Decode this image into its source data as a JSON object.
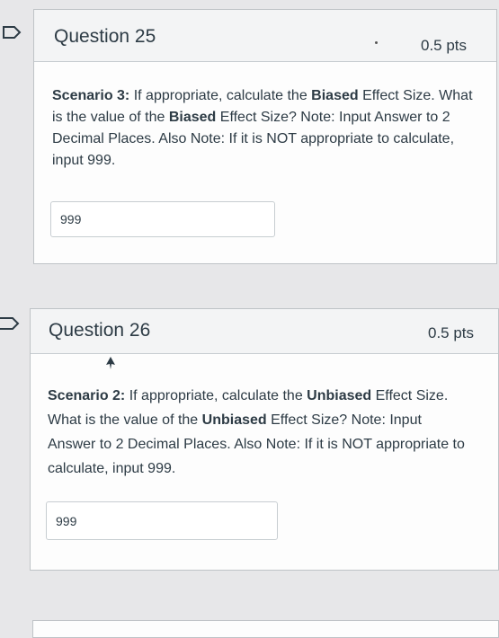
{
  "questions": [
    {
      "title": "Question 25",
      "points": "0.5 pts",
      "scenario_label": "Scenario 3:",
      "text_1": " If appropriate, calculate the ",
      "bold_1": "Biased",
      "text_2": " Effect Size. What is the value of the ",
      "bold_2": "Biased",
      "text_3": " Effect Size? Note: Input Answer to 2 Decimal Places. Also Note: If it is NOT appropriate to calculate, input 999.",
      "answer_value": "999"
    },
    {
      "title": "Question 26",
      "points": "0.5 pts",
      "scenario_label": "Scenario 2:",
      "text_1": " If appropriate, calculate the ",
      "bold_1": "Unbiased",
      "text_2": " Effect Size. What is the value of the ",
      "bold_2": "Unbiased",
      "text_3": " Effect Size? Note: Input Answer to 2 Decimal Places. Also Note: If it is NOT appropriate to calculate, input 999.",
      "answer_value": "999"
    }
  ],
  "icons": {
    "flag": "flag-icon",
    "cursor": "cursor-arrow-icon"
  }
}
